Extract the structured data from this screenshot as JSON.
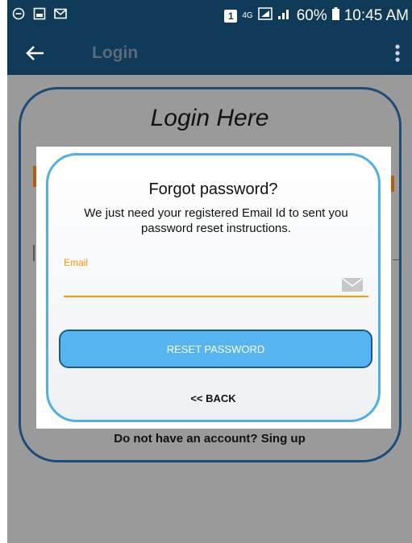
{
  "status_bar": {
    "sim": "1",
    "network": "4G",
    "battery": "60%",
    "time": "10:45 AM"
  },
  "app_bar": {
    "title": "Login"
  },
  "background": {
    "title": "Login Here",
    "signup_text": "Do not have an account? Sing up"
  },
  "dialog": {
    "title": "Forgot password?",
    "message": "We just need your registered Email Id to sent you password reset instructions.",
    "email_label": "Email",
    "email_value": "",
    "reset_button": "RESET PASSWORD",
    "back_label": "<< BACK"
  },
  "colors": {
    "appbar": "#0f3a58",
    "accent": "#ff9800",
    "button": "#56b4f0",
    "dialog_border": "#4fb0e6"
  },
  "icons": {
    "status_left": [
      "minus-circle-icon",
      "image-icon",
      "message-icon"
    ],
    "appbar_left": "back-arrow-icon",
    "appbar_right": "more-vert-icon",
    "email_field": "mail-icon"
  }
}
